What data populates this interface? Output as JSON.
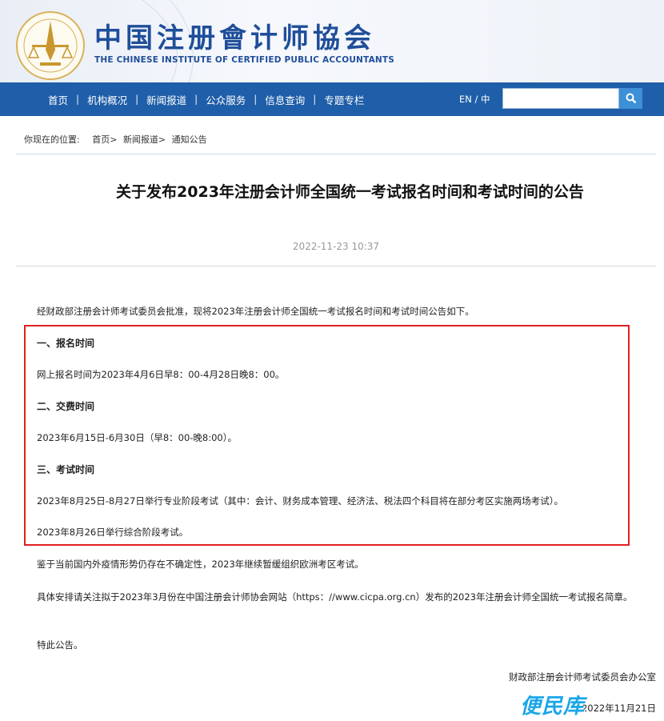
{
  "header": {
    "cn_title": "中国注册會计师協会",
    "en_title": "THE CHINESE INSTITUTE OF CERTIFIED PUBLIC ACCOUNTANTS"
  },
  "nav": {
    "items": [
      {
        "label": "首页"
      },
      {
        "label": "机构概况"
      },
      {
        "label": "新闻报道"
      },
      {
        "label": "公众服务"
      },
      {
        "label": "信息查询"
      },
      {
        "label": "专题专栏"
      }
    ],
    "separator": "|",
    "lang": "EN / 中",
    "search_value": ""
  },
  "breadcrumb": {
    "prefix": "你现在的位置:",
    "items": [
      "首页>",
      "新闻报道>",
      "通知公告"
    ]
  },
  "article": {
    "title": "关于发布2023年注册会计师全国统一考试报名时间和考试时间的公告",
    "date": "2022-11-23 10:37",
    "intro": "经财政部注册会计师考试委员会批准，现将2023年注册会计师全国统一考试报名时间和考试时间公告如下。",
    "sections": [
      {
        "heading": "一、报名时间",
        "lines": [
          "网上报名时间为2023年4月6日早8：00-4月28日晚8：00。"
        ]
      },
      {
        "heading": "二、交费时间",
        "lines": [
          "2023年6月15日-6月30日（早8：00-晚8:00）。"
        ]
      },
      {
        "heading": "三、考试时间",
        "lines": [
          "2023年8月25日-8月27日举行专业阶段考试（其中：会计、财务成本管理、经济法、税法四个科目将在部分考区实施两场考试）。",
          "2023年8月26日举行综合阶段考试。"
        ]
      }
    ],
    "para_covid": "鉴于当前国内外疫情形势仍存在不确定性，2023年继续暂缓组织欧洲考区考试。",
    "para_arrange": "具体安排请关注拟于2023年3月份在中国注册会计师协会网站（https：//www.cicpa.org.cn）发布的2023年注册会计师全国统一考试报名简章。",
    "para_end": "特此公告。",
    "signer": "财政部注册会计师考试委员会办公室",
    "sign_date": "2022年11月21日"
  },
  "watermark": "便民库",
  "colors": {
    "nav_bg": "#1f5ea8",
    "title_blue": "#1f4e9a",
    "highlight_border": "#e02020"
  },
  "icons": {
    "search": "magnifier-icon",
    "logo": "cicpa-emblem-icon"
  }
}
